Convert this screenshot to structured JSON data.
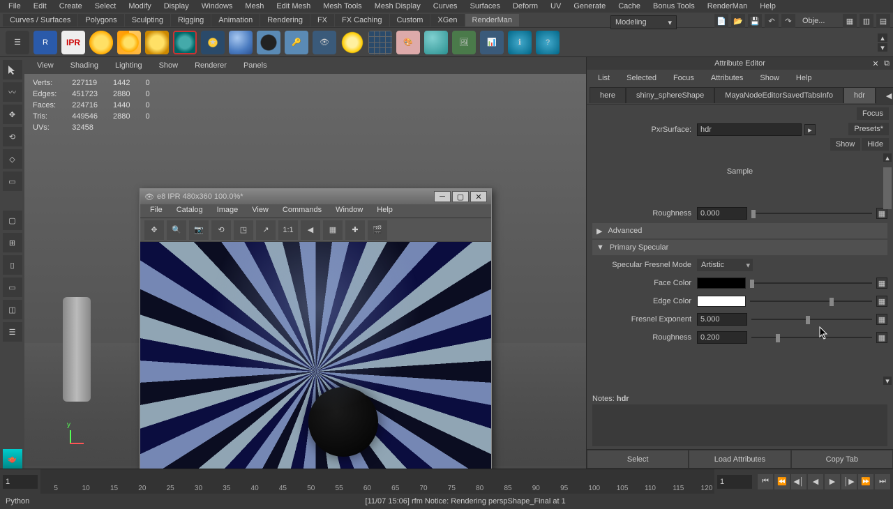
{
  "menubar": [
    "File",
    "Edit",
    "Create",
    "Select",
    "Modify",
    "Display",
    "Windows",
    "Mesh",
    "Edit Mesh",
    "Mesh Tools",
    "Mesh Display",
    "Curves",
    "Surfaces",
    "Deform",
    "UV",
    "Generate",
    "Cache",
    "Bonus Tools",
    "RenderMan",
    "Help"
  ],
  "shelf_tabs": [
    "Curves / Surfaces",
    "Polygons",
    "Sculpting",
    "Rigging",
    "Animation",
    "Rendering",
    "FX",
    "FX Caching",
    "Custom",
    "XGen",
    "RenderMan"
  ],
  "shelf_tab_active": "RenderMan",
  "mode_dropdown": "Modeling",
  "top_right_label": "Obje...",
  "viewport_menu": [
    "View",
    "Shading",
    "Lighting",
    "Show",
    "Renderer",
    "Panels"
  ],
  "stats": {
    "headers": [
      "",
      "",
      "",
      ""
    ],
    "rows": [
      [
        "Verts:",
        "227119",
        "1442",
        "0"
      ],
      [
        "Edges:",
        "451723",
        "2880",
        "0"
      ],
      [
        "Faces:",
        "224716",
        "1440",
        "0"
      ],
      [
        "Tris:",
        "449546",
        "2880",
        "0"
      ],
      [
        "UVs:",
        "32458",
        "",
        "",
        ""
      ]
    ]
  },
  "axis_label": "y",
  "render_window": {
    "title": "e8 IPR 480x360 100.0%*",
    "menu": [
      "File",
      "Catalog",
      "Image",
      "View",
      "Commands",
      "Window",
      "Help"
    ],
    "zoom_label": "1:1"
  },
  "attr": {
    "title": "Attribute Editor",
    "menu": [
      "List",
      "Selected",
      "Focus",
      "Attributes",
      "Show",
      "Help"
    ],
    "tabs": [
      "here",
      "shiny_sphereShape",
      "MayaNodeEditorSavedTabsInfo",
      "hdr"
    ],
    "active_tab": "hdr",
    "right_col": {
      "focus": "Focus",
      "presets": "Presets*",
      "show": "Show",
      "hide": "Hide"
    },
    "pxrsurface_label": "PxrSurface:",
    "pxrsurface_value": "hdr",
    "sample_label": "Sample",
    "sect_advanced": "Advanced",
    "sect_primary": "Primary Specular",
    "rows": {
      "roughness1": {
        "label": "Roughness",
        "value": "0.000"
      },
      "fresnel_mode": {
        "label": "Specular Fresnel Mode",
        "value": "Artistic"
      },
      "face_color": {
        "label": "Face Color"
      },
      "edge_color": {
        "label": "Edge Color"
      },
      "fresnel_exp": {
        "label": "Fresnel Exponent",
        "value": "5.000"
      },
      "roughness2": {
        "label": "Roughness",
        "value": "0.200"
      }
    },
    "notes_label": "Notes: ",
    "notes_value": "hdr",
    "buttons": [
      "Select",
      "Load Attributes",
      "Copy Tab"
    ]
  },
  "timeline": {
    "start": "1",
    "current": "1",
    "ticks": [
      5,
      10,
      15,
      20,
      25,
      30,
      35,
      40,
      45,
      50,
      55,
      60,
      65,
      70,
      75,
      80,
      85,
      90,
      95,
      100,
      105,
      110,
      115,
      120
    ]
  },
  "status": {
    "lang": "Python",
    "msg": "[11/07 15:06] rfm Notice: Rendering perspShape_Final at 1"
  }
}
